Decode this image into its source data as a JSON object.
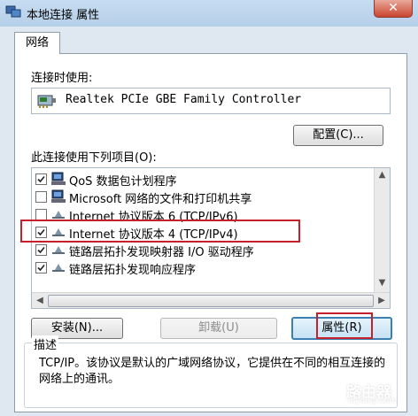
{
  "window": {
    "title": "本地连接 属性",
    "close_glyph": "✕"
  },
  "tabs": [
    {
      "label": "网络"
    }
  ],
  "connect_using": {
    "label": "连接时使用:",
    "adapter_name": "Realtek PCIe GBE Family Controller",
    "configure_button": "配置(C)..."
  },
  "items_section": {
    "label": "此连接使用下列项目(O):",
    "items": [
      {
        "label": "QoS 数据包计划程序",
        "checked": true,
        "icon": "network-client-icon"
      },
      {
        "label": "Microsoft 网络的文件和打印机共享",
        "checked": false,
        "icon": "network-client-icon"
      },
      {
        "label": "Internet 协议版本 6 (TCP/IPv6)",
        "checked": false,
        "icon": "protocol-icon"
      },
      {
        "label": "Internet 协议版本 4 (TCP/IPv4)",
        "checked": true,
        "icon": "protocol-icon",
        "highlighted": true
      },
      {
        "label": "链路层拓扑发现映射器 I/O 驱动程序",
        "checked": true,
        "icon": "protocol-icon"
      },
      {
        "label": "链路层拓扑发现响应程序",
        "checked": true,
        "icon": "protocol-icon"
      }
    ]
  },
  "buttons": {
    "install": "安装(N)...",
    "uninstall": "卸载(U)",
    "properties": "属性(R)"
  },
  "description": {
    "title": "描述",
    "text": "TCP/IP。该协议是默认的广域网络协议，它提供在不同的相互连接的网络上的通讯。"
  },
  "watermark": {
    "text": "路由器",
    "url": "luyouqi.com"
  },
  "colors": {
    "highlight_frame": "#c8202a",
    "focus_border": "#3c7fb1"
  }
}
